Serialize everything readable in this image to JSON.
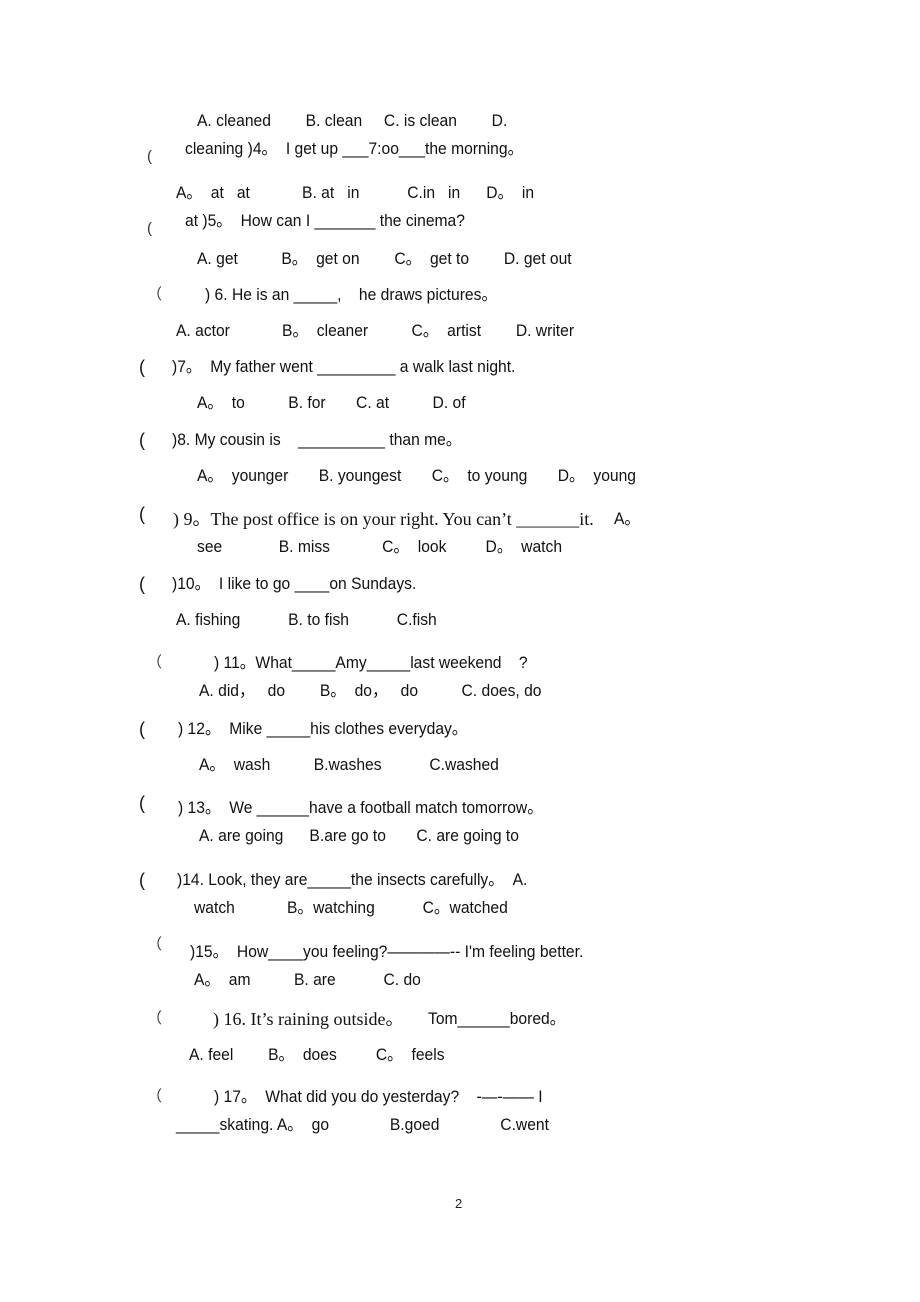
{
  "page_number": "2",
  "lines": {
    "q3_options_1": "A. cleaned        B. clean     C. is clean        D.",
    "q3_options_2": "cleaning )4。  I get up ___7:oo___the morning。",
    "q4_options_1": "A。  at   at            B. at   in           C.in   in      D。  in",
    "q4_options_2": "at )5。  How can I _______ the cinema?",
    "q5_options": "A. get          B。  get on        C。  get to        D. get out",
    "q6_stem": ") 6. He is an _____,    he draws pictures。",
    "q6_options": "A. actor            B。  cleaner          C。  artist        D. writer",
    "q7_stem": ")7。  My father went _________ a walk last night.",
    "q7_options": "A。  to          B. for       C. at          D. of",
    "q8_stem": ")8. My cousin is    __________ than me。",
    "q8_options": "A。  younger       B. youngest       C。  to young       D。  young",
    "q9_stem": ") 9。The post office is on your right. You can’t _______it.",
    "q9_stem_tail": "A。",
    "q9_options": "see             B. miss            C。  look         D。  watch",
    "q10_stem": ")10。  I like to go ____on Sundays.",
    "q10_options": "A. fishing           B. to fish           C.fish",
    "q11_stem": ") 11。What_____Amy_____last weekend    ?",
    "q11_options": "A. did，   do        B。  do，   do          C. does, do",
    "q12_stem": ") 12。  Mike _____his clothes everyday。",
    "q12_options": "A。  wash          B.washes           C.washed",
    "q13_stem": ") 13。  We ______have a football match tomorrow。",
    "q13_options": "A. are going      B.are go to       C. are going to",
    "q14_stem": ")14. Look, they are_____the insects carefully。  A.",
    "q14_options": "watch            B。watching           C。watched",
    "q15_stem": ")15。  How____you feeling?————-- I'm feeling better.",
    "q15_options": "A。  am          B. are           C. do",
    "q16_stem_serif": ") 16. It’s raining outside。",
    "q16_stem_tail": "Tom______bored。",
    "q16_options": "A. feel        B。  does         C。  feels",
    "q17_stem": ") 17。  What did you do yesterday?    -—-—— I",
    "q17_options": "_____skating. A。  go              B.goed              C.went"
  },
  "parens": {
    "open": "(",
    "open_fw": "（"
  }
}
